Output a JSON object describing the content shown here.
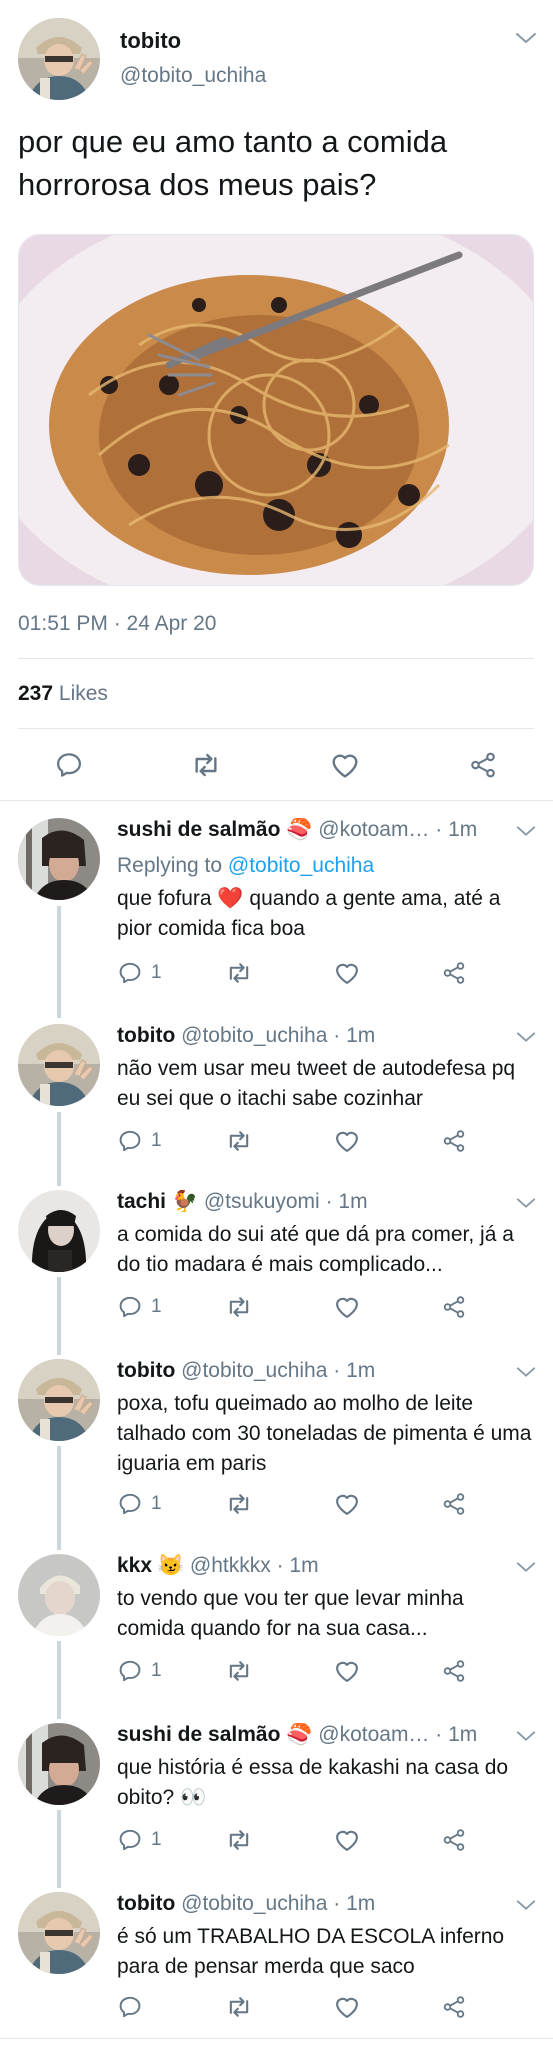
{
  "main_tweet": {
    "display_name": "tobito",
    "handle": "@tobito_uchiha",
    "text": "por que eu amo tanto a comida horrorosa dos meus pais?",
    "timestamp": "01:51 PM · 24 Apr 20",
    "likes_count": "237",
    "likes_label": "Likes",
    "caret_icon": "chevron-down-icon",
    "actions": [
      "reply-icon",
      "retweet-icon",
      "like-icon",
      "share-icon"
    ]
  },
  "replies": [
    {
      "display_name": "sushi de salmão",
      "name_emoji": "🍣",
      "handle": "@kotoam…",
      "time": "· 1m",
      "replying_label": "Replying to",
      "replying_to": "@tobito_uchiha",
      "text_1": "que fofura",
      "emoji": "❤️",
      "text_2": "quando a gente ama, até a pior comida fica boa",
      "reply_count": "1"
    },
    {
      "display_name": "tobito",
      "handle": "@tobito_uchiha",
      "time": "· 1m",
      "text": "não vem usar meu tweet de autodefesa pq eu sei que o itachi sabe cozinhar",
      "reply_count": "1"
    },
    {
      "display_name": "tachi",
      "name_emoji": "🐓",
      "handle": "@tsukuyomi",
      "time": "· 1m",
      "text": "a comida do sui até que dá pra comer, já a do tio madara é mais complicado...",
      "reply_count": "1"
    },
    {
      "display_name": "tobito",
      "handle": "@tobito_uchiha",
      "time": "· 1m",
      "text": "poxa, tofu queimado ao molho de leite talhado com 30 toneladas de pimenta é uma iguaria em paris",
      "reply_count": "1"
    },
    {
      "display_name": "kkx",
      "name_emoji": "😼",
      "handle": "@htkkkx",
      "time": "· 1m",
      "text": "to vendo que vou ter que levar minha comida quando for na sua casa...",
      "reply_count": "1"
    },
    {
      "display_name": "sushi de salmão",
      "name_emoji": "🍣",
      "handle": "@kotoam…",
      "time": "· 1m",
      "text": "que história é essa de kakashi na casa do obito?",
      "emoji": "👀",
      "reply_count": "1"
    },
    {
      "display_name": "tobito",
      "handle": "@tobito_uchiha",
      "time": "· 1m",
      "text": "é só um TRABALHO DA ESCOLA inferno para de pensar merda que saco",
      "reply_count": ""
    }
  ],
  "colors": {
    "text": "#14171a",
    "muted": "#657786",
    "link": "#1da1f2",
    "divider": "#e1e8ed",
    "thread_line": "#ccd6dd",
    "heart_red": "#e0245e"
  }
}
